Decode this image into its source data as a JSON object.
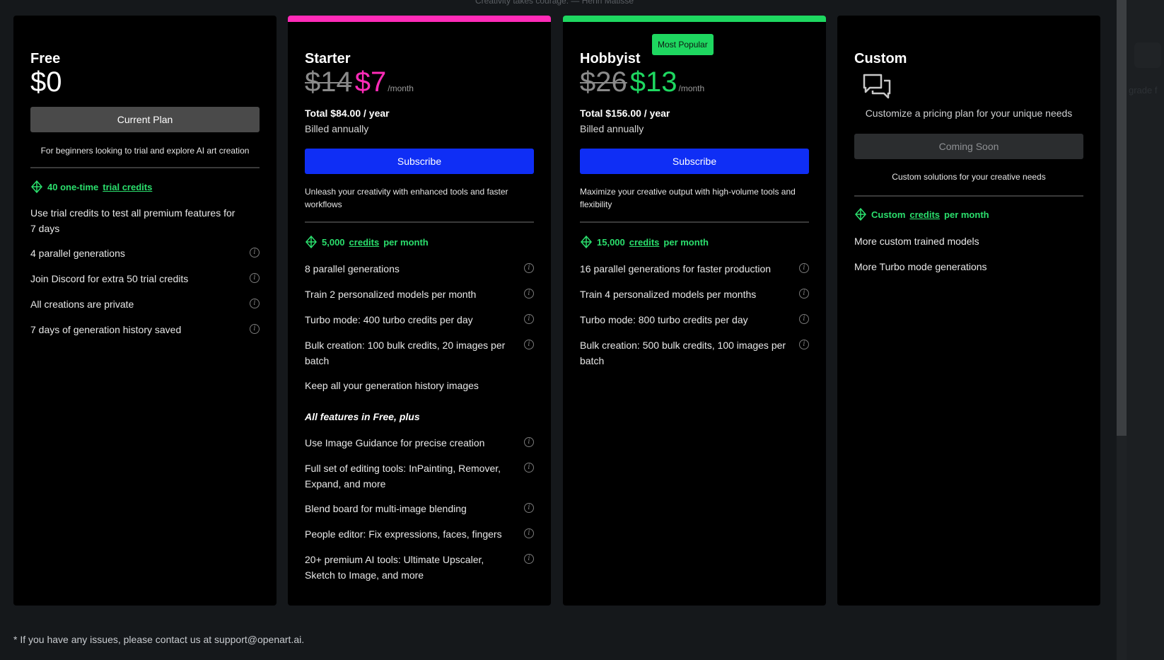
{
  "top_quote": "Creativity takes courage.  —  Henri Matisse",
  "backdrop_peek": "grade f",
  "plans": {
    "free": {
      "name": "Free",
      "price": "$0",
      "button": "Current Plan",
      "description": "For beginners looking to trial and explore AI art creation",
      "credits_prefix": "40 one-time",
      "credits_link": "trial credits",
      "features": [
        "Use trial credits to test all premium features for 7 days",
        "4 parallel generations",
        "Join Discord for extra 50 trial credits",
        "All creations are private",
        "7 days of generation history saved"
      ]
    },
    "starter": {
      "name": "Starter",
      "old_price": "$14",
      "new_price": "$7",
      "per": "/month",
      "total": "Total $84.00 / year",
      "billed": "Billed annually",
      "button": "Subscribe",
      "description": "Unleash your creativity with enhanced tools and faster workflows",
      "credits_prefix": "5,000",
      "credits_link": "credits",
      "credits_suffix": "per month",
      "features": [
        "8 parallel generations",
        "Train 2 personalized models per month",
        "Turbo mode: 400 turbo credits per day",
        "Bulk creation: 100 bulk credits, 20 images per batch",
        "Keep all your generation history images"
      ],
      "section_head": "All features in Free, plus",
      "extra_features": [
        "Use Image Guidance for precise creation",
        "Full set of editing tools: InPainting, Remover, Expand, and more",
        "Blend board for multi-image blending",
        "People editor: Fix expressions, faces, fingers",
        "20+ premium AI tools: Ultimate Upscaler, Sketch to Image, and more"
      ]
    },
    "hobbyist": {
      "name": "Hobbyist",
      "badge": "Most Popular",
      "old_price": "$26",
      "new_price": "$13",
      "per": "/month",
      "total": "Total $156.00 / year",
      "billed": "Billed annually",
      "button": "Subscribe",
      "description": "Maximize your creative output with high-volume tools and flexibility",
      "credits_prefix": "15,000",
      "credits_link": "credits",
      "credits_suffix": "per month",
      "features": [
        "16 parallel generations for faster production",
        "Train 4 personalized models per months",
        "Turbo mode: 800 turbo credits per day",
        "Bulk creation: 500 bulk credits, 100 images per batch"
      ]
    },
    "custom": {
      "name": "Custom",
      "tagline": "Customize a pricing plan for your unique needs",
      "button": "Coming Soon",
      "description": "Custom solutions for your creative needs",
      "credits_prefix": "Custom",
      "credits_link": "credits",
      "credits_suffix": "per month",
      "features": [
        "More custom trained models",
        "More Turbo mode generations"
      ]
    }
  },
  "footer": "* If you have any issues, please contact us at support@openart.ai.",
  "colors": {
    "starter_accent": "#ff2bb8",
    "hobbyist_accent": "#1ed760",
    "subscribe_blue": "#0f2ef5",
    "credit_green": "#2bdf6d"
  }
}
